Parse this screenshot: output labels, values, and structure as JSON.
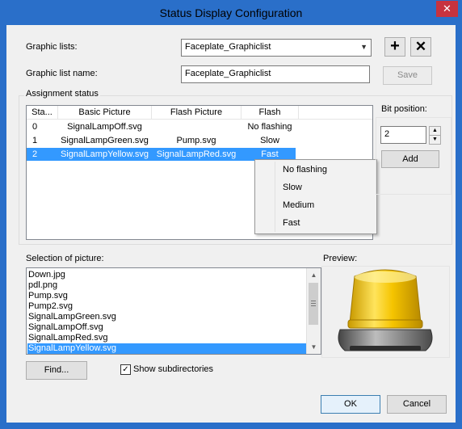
{
  "window": {
    "title": "Status Display Configuration",
    "close_glyph": "✕"
  },
  "graphic_lists": {
    "label": "Graphic lists:",
    "value": "Faceplate_Graphiclist",
    "add_glyph": "+",
    "delete_glyph": "✕"
  },
  "graphic_list_name": {
    "label": "Graphic list name:",
    "value": "Faceplate_Graphiclist",
    "save_label": "Save"
  },
  "assignment": {
    "group_label": "Assignment status",
    "columns": [
      "Sta...",
      "Basic Picture",
      "Flash Picture",
      "Flash"
    ],
    "rows": [
      {
        "status": "0",
        "basic": "SignalLampOff.svg",
        "flash_pic": "",
        "flash": "No flashing"
      },
      {
        "status": "1",
        "basic": "SignalLampGreen.svg",
        "flash_pic": "Pump.svg",
        "flash": "Slow"
      },
      {
        "status": "2",
        "basic": "SignalLampYellow.svg",
        "flash_pic": "SignalLampRed.svg",
        "flash": "Fast"
      }
    ]
  },
  "flash_menu": {
    "items": [
      "No flashing",
      "Slow",
      "Medium",
      "Fast"
    ]
  },
  "bit_position": {
    "label": "Bit position:",
    "value": "2",
    "add_label": "Add"
  },
  "selection": {
    "label": "Selection of picture:",
    "items": [
      "Down.jpg",
      "pdl.png",
      "Pump.svg",
      "Pump2.svg",
      "SignalLampGreen.svg",
      "SignalLampOff.svg",
      "SignalLampRed.svg",
      "SignalLampYellow.svg"
    ],
    "selected_index": 7
  },
  "preview": {
    "label": "Preview:"
  },
  "find_label": "Find...",
  "show_subdirectories": {
    "label": "Show subdirectories",
    "checked": true,
    "check_glyph": "✓"
  },
  "dialog_buttons": {
    "ok": "OK",
    "cancel": "Cancel"
  },
  "colors": {
    "title_bar": "#2a6fc9",
    "close_button": "#c7333f",
    "selection": "#3399ff",
    "lamp_yellow": "#f5c400"
  }
}
